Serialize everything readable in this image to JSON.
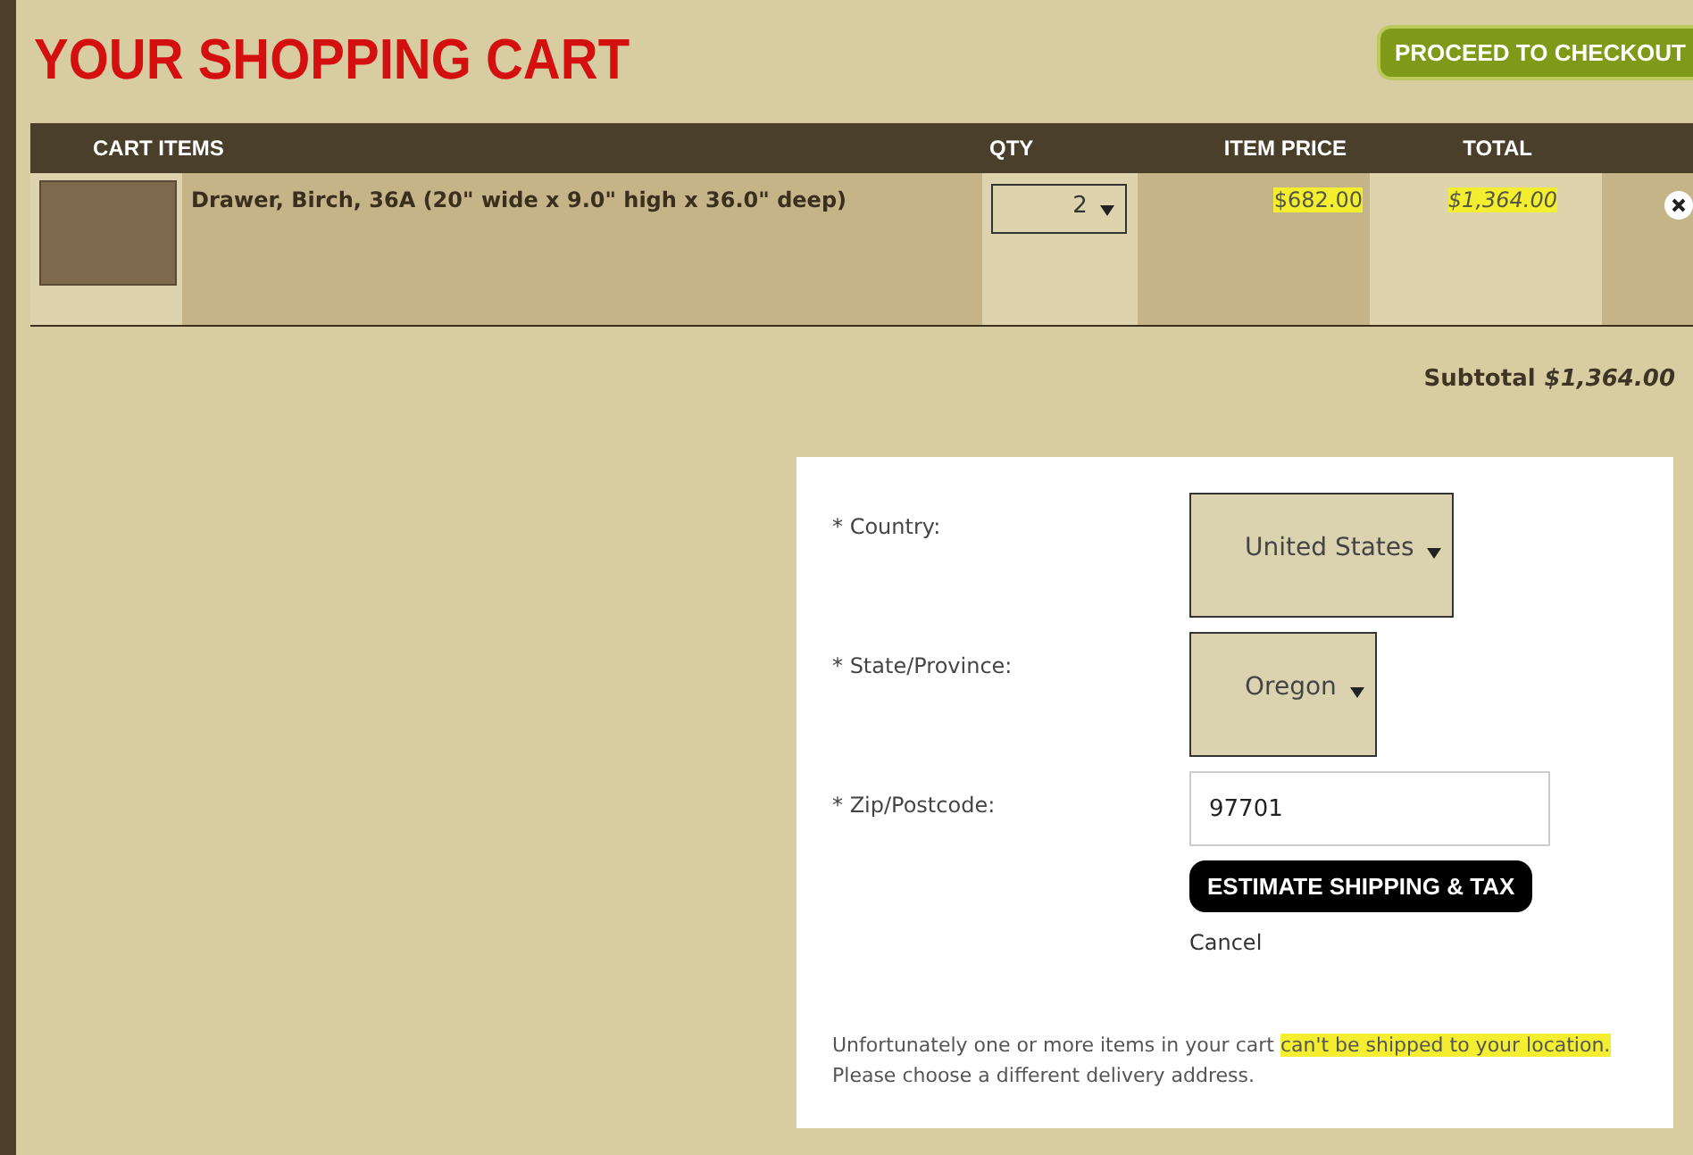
{
  "page_title": "YOUR SHOPPING CART",
  "checkout_button": "PROCEED TO CHECKOUT",
  "table": {
    "columns": [
      "CART ITEMS",
      "QTY",
      "ITEM PRICE",
      "TOTAL"
    ],
    "rows": [
      {
        "name": "Drawer, Birch, 36A (20\" wide x 9.0\" high x 36.0\" deep)",
        "qty": "2",
        "price": "$682.00",
        "price_highlighted": true,
        "total": "$1,364.00",
        "total_highlighted": true
      }
    ]
  },
  "subtotal": {
    "label": "Subtotal",
    "value": "$1,364.00"
  },
  "shipping_form": {
    "fields": [
      {
        "kind": "select",
        "label": "* Country:",
        "value": "United States"
      },
      {
        "kind": "select",
        "label": "* State/Province:",
        "value": "Oregon"
      },
      {
        "kind": "text",
        "label": "* Zip/Postcode:",
        "value": "97701"
      }
    ],
    "estimate_button": "ESTIMATE SHIPPING & TAX",
    "cancel_link": "Cancel",
    "message": {
      "before": "Unfortunately one or more items in your cart ",
      "highlighted": "can't be shipped to your location.",
      "after": "Please choose a different delivery address."
    }
  }
}
